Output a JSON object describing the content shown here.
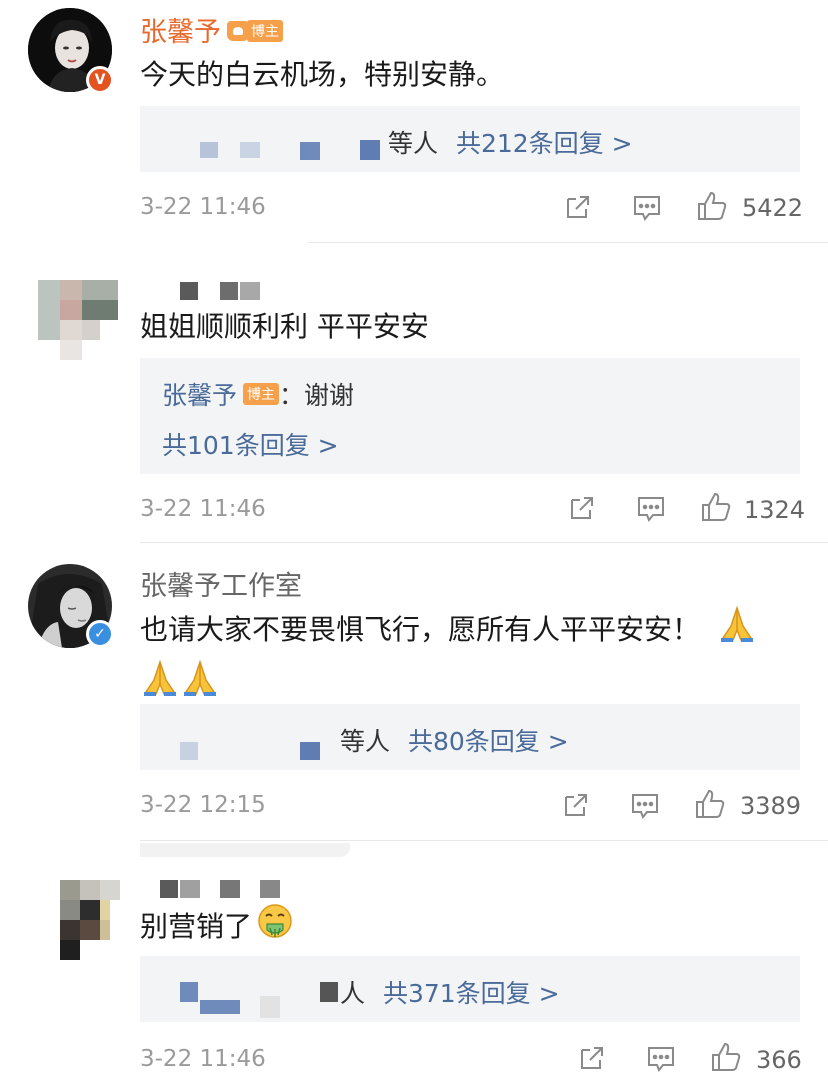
{
  "comments": [
    {
      "name": "张馨予",
      "tag": "博主",
      "text": "今天的白云机场，特别安静。",
      "reply_suffix": "等人",
      "reply_count": "共212条回复 >",
      "time": "3-22 11:46",
      "likes": "5422",
      "badge": "V",
      "avatar_alt": "avatar"
    },
    {
      "text": "姐姐顺顺利利 平平安安",
      "reply_name": "张馨予",
      "reply_tag": "博主",
      "reply_colon": "：",
      "reply_text": "谢谢",
      "reply_count": "共101条回复 >",
      "time": "3-22 11:46",
      "likes": "1324"
    },
    {
      "name": "张馨予工作室",
      "text": "也请大家不要畏惧飞行，愿所有人平平安安！",
      "reply_suffix": "等人",
      "reply_count": "共80条回复 >",
      "time": "3-22 12:15",
      "likes": "3389",
      "badge": "✓"
    },
    {
      "text": "别营销了",
      "reply_suffix": "人",
      "reply_count": "共371条回复 >",
      "time": "3-22 11:46",
      "likes": "366"
    }
  ],
  "colors": {
    "accent_orange": "#e8692d",
    "link_blue": "#4a6a9a",
    "tag_orange": "#f7a04b",
    "verified_orange": "#e2531f",
    "verified_blue": "#3a8fe0"
  },
  "icons": [
    "share-icon",
    "comment-icon",
    "like-icon",
    "pray-emoji",
    "vomit-emoji"
  ]
}
